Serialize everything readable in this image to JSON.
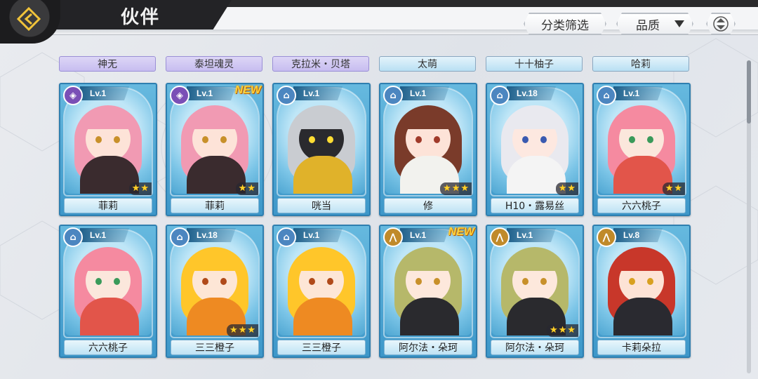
{
  "header": {
    "title": "伙伴",
    "filter_label": "分类筛选",
    "quality_label": "品质"
  },
  "top_names": [
    "神无",
    "泰坦魂灵",
    "克拉米・贝塔",
    "太萌",
    "十十柚子",
    "哈莉"
  ],
  "top_name_colors": [
    "purple",
    "purple",
    "purple",
    "blue",
    "blue",
    "blue"
  ],
  "cards": [
    {
      "name": "菲莉",
      "level": "Lv.1",
      "new": "",
      "stars": 2,
      "class": "purple",
      "hair": "#f19ab3",
      "skin": "#fde3d8",
      "outfit": "#3a2b2e",
      "eye": "#c8902a"
    },
    {
      "name": "菲莉",
      "level": "Lv.1",
      "new": "NEW",
      "stars": 2,
      "class": "purple",
      "hair": "#f19ab3",
      "skin": "#fde3d8",
      "outfit": "#3a2b2e",
      "eye": "#c8902a"
    },
    {
      "name": "咣当",
      "level": "Lv.1",
      "new": "",
      "stars": 0,
      "class": "blue",
      "hair": "#c9ccd1",
      "skin": "#2a2a2e",
      "outfit": "#e0b22a",
      "eye": "#ffdd33"
    },
    {
      "name": "修",
      "level": "Lv.1",
      "new": "",
      "stars": 3,
      "class": "blue",
      "hair": "#7a3b2a",
      "skin": "#fde3d8",
      "outfit": "#f2f2ee",
      "eye": "#a03a2a"
    },
    {
      "name": "H10・露易丝",
      "level": "Lv.18",
      "new": "",
      "stars": 2,
      "class": "blue",
      "hair": "#e9e9ef",
      "skin": "#fde8e0",
      "outfit": "#f4f4f4",
      "eye": "#3a5ab0"
    },
    {
      "name": "六六桃子",
      "level": "Lv.1",
      "new": "",
      "stars": 2,
      "class": "blue",
      "hair": "#f58aa0",
      "skin": "#fbe7dc",
      "outfit": "#e2554a",
      "eye": "#3a9a5a"
    },
    {
      "name": "六六桃子",
      "level": "Lv.1",
      "new": "",
      "stars": 0,
      "class": "blue",
      "hair": "#f58aa0",
      "skin": "#fbe7dc",
      "outfit": "#e2554a",
      "eye": "#3a9a5a"
    },
    {
      "name": "三三橙子",
      "level": "Lv.18",
      "new": "",
      "stars": 3,
      "class": "blue",
      "hair": "#ffc62a",
      "skin": "#fde6d6",
      "outfit": "#ee8a22",
      "eye": "#b04a1a"
    },
    {
      "name": "三三橙子",
      "level": "Lv.1",
      "new": "",
      "stars": 0,
      "class": "blue",
      "hair": "#ffc62a",
      "skin": "#fde6d6",
      "outfit": "#ee8a22",
      "eye": "#b04a1a"
    },
    {
      "name": "阿尔法・朵珂",
      "level": "Lv.1",
      "new": "NEW",
      "stars": 0,
      "class": "gold",
      "hair": "#b6b86a",
      "skin": "#fde8dc",
      "outfit": "#2a2a2e",
      "eye": "#c8902a"
    },
    {
      "name": "阿尔法・朵珂",
      "level": "Lv.1",
      "new": "",
      "stars": 3,
      "class": "gold",
      "hair": "#b6b86a",
      "skin": "#fde8dc",
      "outfit": "#2a2a2e",
      "eye": "#c8902a"
    },
    {
      "name": "卡莉朵拉",
      "level": "Lv.8",
      "new": "",
      "stars": 0,
      "class": "gold",
      "hair": "#c8372a",
      "skin": "#fde3d6",
      "outfit": "#2a2a30",
      "eye": "#d8a020"
    }
  ]
}
